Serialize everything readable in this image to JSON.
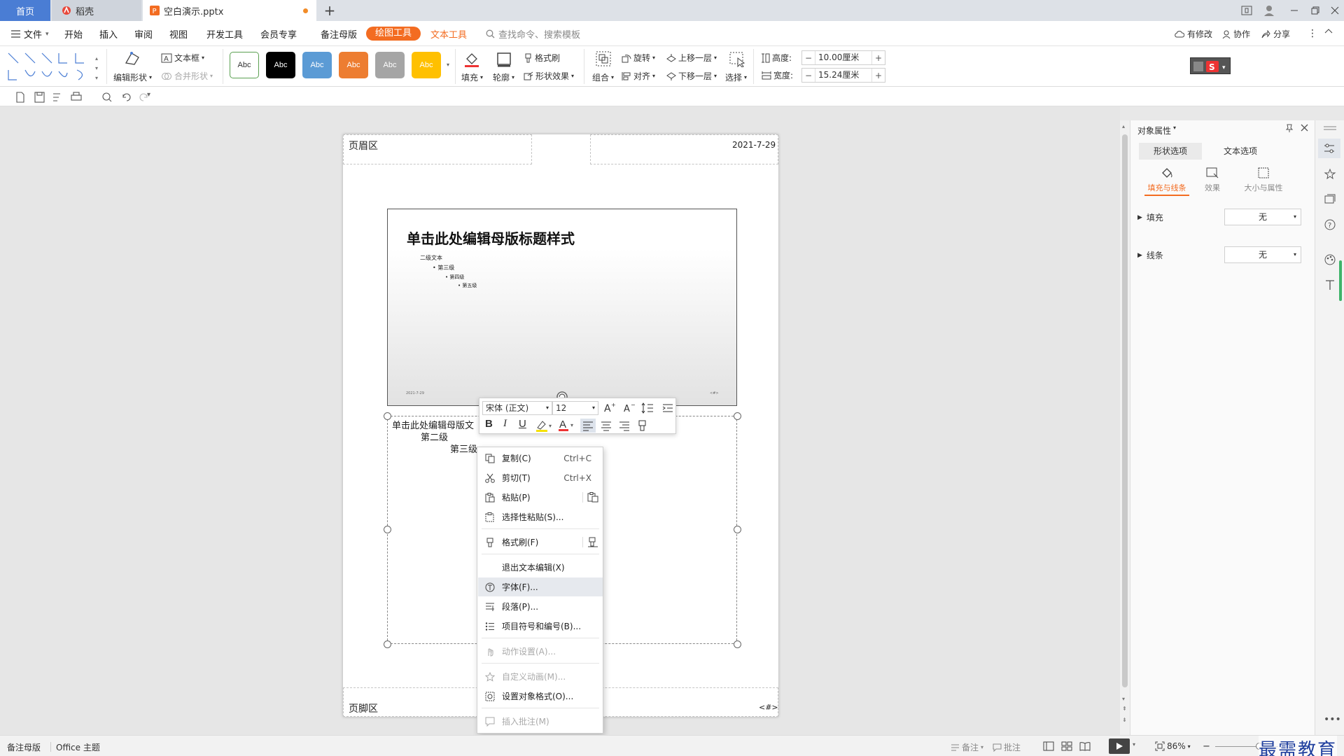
{
  "titlebar": {
    "tabs": [
      {
        "label": "首页"
      },
      {
        "label": "稻壳"
      },
      {
        "label": "空白演示.pptx"
      }
    ],
    "add_tab": "+"
  },
  "menubar": {
    "file_label": "文件",
    "items": [
      "开始",
      "插入",
      "审阅",
      "视图",
      "开发工具",
      "会员专享",
      "备注母版"
    ],
    "active_tab": "绘图工具",
    "text_tool": "文本工具",
    "search_placeholder": "查找命令、搜索模板",
    "right": {
      "modified": "有修改",
      "collab": "协作",
      "share": "分享"
    }
  },
  "ribbon": {
    "edit_shape": "编辑形状",
    "text_box": "文本框",
    "merge_shape": "合并形状",
    "style_labels": [
      "Abc",
      "Abc",
      "Abc",
      "Abc",
      "Abc",
      "Abc"
    ],
    "fill": "填充",
    "outline": "轮廓",
    "format_painter": "格式刷",
    "shape_effect": "形状效果",
    "group": "组合",
    "rotate": "旋转",
    "align": "对齐",
    "bring_forward": "上移一层",
    "send_backward": "下移一层",
    "select": "选择",
    "height_label": "高度:",
    "height_value": "10.00厘米",
    "width_label": "宽度:",
    "width_value": "15.24厘米"
  },
  "page": {
    "header_area": "页眉区",
    "date": "2021-7-29",
    "footer_area": "页脚区",
    "page_num": "<#>"
  },
  "slide": {
    "title": "单击此处编辑母版标题样式",
    "level1": "二级文本",
    "level2": "第三级",
    "level3": "第四级",
    "level4": "第五级",
    "footer_date": "2021-7-29",
    "footer_num": "<#>"
  },
  "notes": {
    "line1": "单击此处编辑母版文",
    "line2": "第二级",
    "line3": "第三级"
  },
  "minitoolbar": {
    "font": "宋体 (正文)",
    "size": "12"
  },
  "context_menu": {
    "copy": "复制(C)",
    "copy_sc": "Ctrl+C",
    "cut": "剪切(T)",
    "cut_sc": "Ctrl+X",
    "paste": "粘贴(P)",
    "paste_special": "选择性粘贴(S)...",
    "format_painter": "格式刷(F)",
    "exit_edit": "退出文本编辑(X)",
    "font": "字体(F)...",
    "paragraph": "段落(P)...",
    "bullets": "项目符号和编号(B)...",
    "action": "动作设置(A)...",
    "custom_anim": "自定义动画(M)...",
    "format_object": "设置对象格式(O)...",
    "insert_comment": "插入批注(M)"
  },
  "panel": {
    "title": "对象属性",
    "tab_shape": "形状选项",
    "tab_text": "文本选项",
    "sub_fill_line": "填充与线条",
    "sub_effect": "效果",
    "sub_size": "大小与属性",
    "fill_label": "填充",
    "fill_value": "无",
    "line_label": "线条",
    "line_value": "无"
  },
  "status": {
    "mode": "备注母版",
    "theme": "Office 主题",
    "notes": "备注",
    "comments": "批注",
    "zoom": "86%",
    "watermark": "最需教育"
  },
  "colors": {
    "accent": "#f36c21",
    "home_tab": "#4a7dd4"
  }
}
